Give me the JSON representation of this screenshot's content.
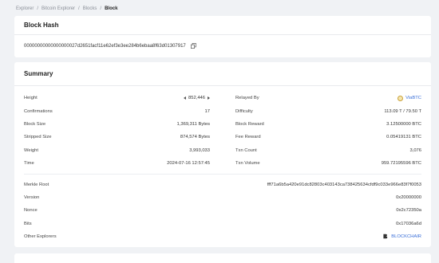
{
  "breadcrumb": {
    "items": [
      "Explorer",
      "Bitcoin Explorer",
      "Blocks"
    ],
    "current": "Block"
  },
  "hash_card": {
    "title": "Block Hash",
    "hash": "00000000000000000027d2651facf11e62ef3e3ee284b6ebaa8f63d01307917"
  },
  "summary": {
    "title": "Summary",
    "left": [
      {
        "label": "Height",
        "value": "852,446"
      },
      {
        "label": "Confirmations",
        "value": "17"
      },
      {
        "label": "Block Size",
        "value": "1,369,311 Bytes"
      },
      {
        "label": "Stripped Size",
        "value": "874,574 Bytes"
      },
      {
        "label": "Weight",
        "value": "3,993,033"
      },
      {
        "label": "Time",
        "value": "2024-07-16 12:57:45"
      }
    ],
    "right": [
      {
        "label": "Relayed By",
        "value": "ViaBTC"
      },
      {
        "label": "Difficulty",
        "value": "113.09 T / 79.50 T"
      },
      {
        "label": "Block Reward",
        "value": "3.12500000 BTC"
      },
      {
        "label": "Fee Reward",
        "value": "0.05419131 BTC"
      },
      {
        "label": "Txn Count",
        "value": "3,076"
      },
      {
        "label": "Txn Volume",
        "value": "959.72195596 BTC"
      }
    ],
    "bottom": [
      {
        "label": "Merkle Root",
        "value": "fff71a6b5a420e91dc82803c403143ca738425634cfdf9c033e966e83f7f0053"
      },
      {
        "label": "Version",
        "value": "0x20000000"
      },
      {
        "label": "Nonce",
        "value": "0x2c72350a"
      },
      {
        "label": "Bits",
        "value": "0x17036a6d"
      },
      {
        "label": "Other Explorers",
        "value": "BLOCKCHAIR"
      }
    ]
  },
  "icons": {
    "copy": "copy-icon",
    "prev": "triangle-left-icon",
    "next": "triangle-right-icon",
    "pool": "viabtc-icon",
    "blockchair": "blockchair-icon"
  },
  "colors": {
    "link": "#3a6fd8",
    "background": "#f0f2f5"
  }
}
